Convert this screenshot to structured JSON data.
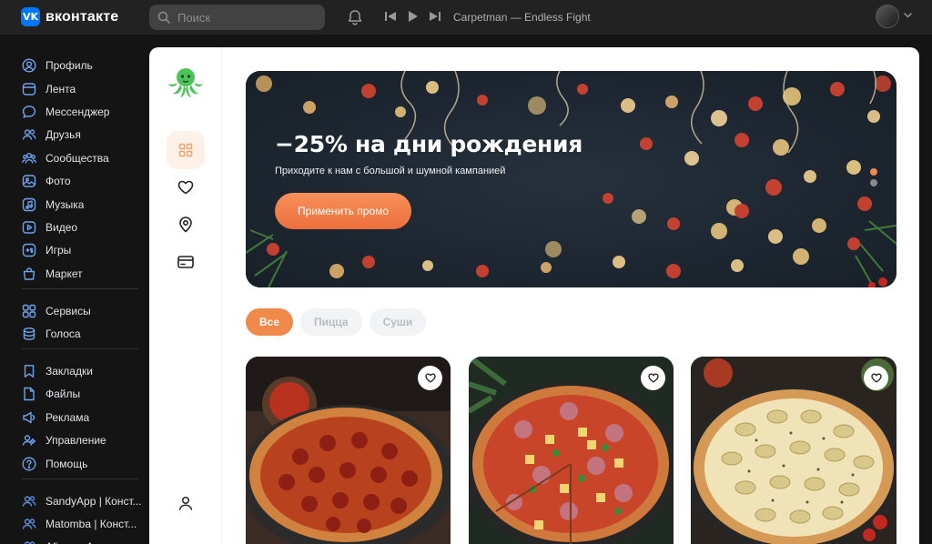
{
  "topbar": {
    "logo_text": "вконтакте",
    "logo_mark": "VK",
    "search_placeholder": "Поиск",
    "track": "Carpetman — Endless Fight"
  },
  "nav": {
    "main": [
      {
        "label": "Профиль",
        "icon": "user-circle-icon"
      },
      {
        "label": "Лента",
        "icon": "feed-icon"
      },
      {
        "label": "Мессенджер",
        "icon": "message-icon"
      },
      {
        "label": "Друзья",
        "icon": "friends-icon"
      },
      {
        "label": "Сообщества",
        "icon": "communities-icon"
      },
      {
        "label": "Фото",
        "icon": "photo-icon"
      },
      {
        "label": "Музыка",
        "icon": "music-icon"
      },
      {
        "label": "Видео",
        "icon": "video-icon"
      },
      {
        "label": "Игры",
        "icon": "games-icon"
      },
      {
        "label": "Маркет",
        "icon": "market-icon"
      }
    ],
    "secondary": [
      {
        "label": "Сервисы",
        "icon": "services-icon"
      },
      {
        "label": "Голоса",
        "icon": "votes-icon"
      }
    ],
    "tertiary": [
      {
        "label": "Закладки",
        "icon": "bookmark-icon"
      },
      {
        "label": "Файлы",
        "icon": "files-icon"
      },
      {
        "label": "Реклама",
        "icon": "ads-icon"
      },
      {
        "label": "Управление",
        "icon": "manage-icon"
      },
      {
        "label": "Помощь",
        "icon": "help-icon"
      }
    ],
    "apps": [
      {
        "label": "SandyApp | Конст...",
        "icon": "app-icon"
      },
      {
        "label": "Matomba | Конст...",
        "icon": "app-icon"
      },
      {
        "label": "Afiana - Автомат...",
        "icon": "app-icon"
      }
    ]
  },
  "banner": {
    "title": "−25% на дни рождения",
    "subtitle": "Приходите к нам с большой и шумной кампанией",
    "button": "Применить промо"
  },
  "filters": [
    "Все",
    "Пицца",
    "Суши"
  ],
  "colors": {
    "accent": "#F08A4B",
    "vk_blue": "#0077FF",
    "topbar": "#222222",
    "sidebar_bg": "#141414"
  }
}
